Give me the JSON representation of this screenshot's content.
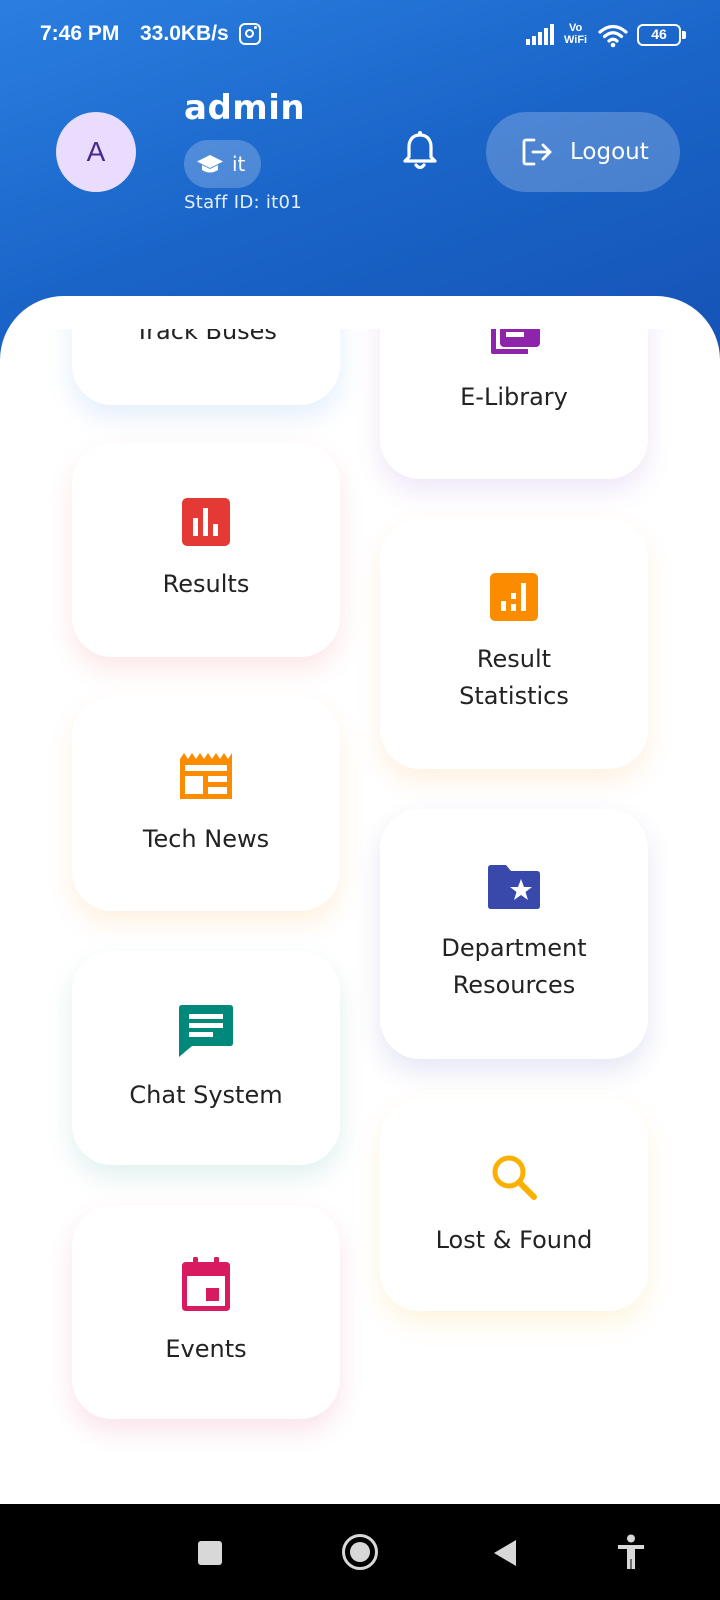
{
  "status_bar": {
    "time": "7:46 PM",
    "speed": "33.0KB/s",
    "vowifi": "Vo\nWiFi",
    "battery": "46"
  },
  "profile": {
    "avatar_letter": "A",
    "username": "admin",
    "department": "it",
    "staff_id": "Staff ID: it01"
  },
  "actions": {
    "logout_label": "Logout"
  },
  "tiles": [
    {
      "label": "Track Buses",
      "icon": "bus-icon",
      "color": "#1e88e5"
    },
    {
      "label": "E-Library",
      "icon": "library-books-icon",
      "color": "#8e24aa"
    },
    {
      "label": "Results",
      "icon": "bar-chart-icon",
      "color": "#e53935"
    },
    {
      "label": "Result Statistics",
      "icon": "analytics-icon",
      "color": "#fb8c00"
    },
    {
      "label": "Tech News",
      "icon": "newspaper-icon",
      "color": "#fb8c00"
    },
    {
      "label": "Department Resources",
      "icon": "folder-special-icon",
      "color": "#3949ab"
    },
    {
      "label": "Chat System",
      "icon": "chat-icon",
      "color": "#00897b"
    },
    {
      "label": "Lost & Found",
      "icon": "search-icon",
      "color": "#fbb000"
    },
    {
      "label": "Events",
      "icon": "event-icon",
      "color": "#d81b60"
    }
  ],
  "colors": {
    "header_gradient_start": "#2a7fe0",
    "header_gradient_end": "#1553b5",
    "avatar_bg": "#e9dcff"
  }
}
